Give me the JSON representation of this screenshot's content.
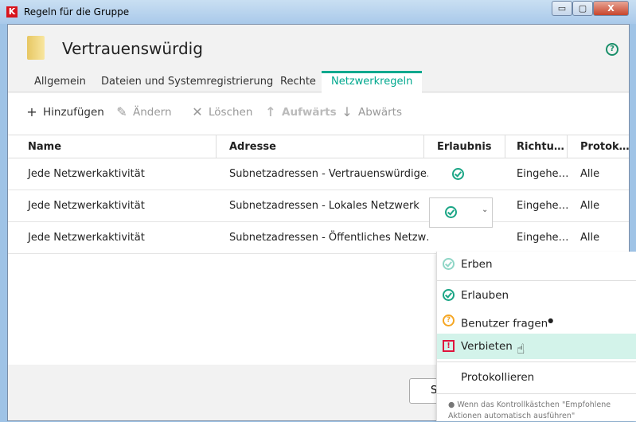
{
  "window": {
    "title": "Regeln für die Gruppe",
    "minimize": "▭",
    "maximize": "▢",
    "close": "X"
  },
  "header": {
    "title": "Vertrauenswürdig",
    "help": "?"
  },
  "tabs": [
    {
      "label": "Allgemein"
    },
    {
      "label": "Dateien und Systemregistrierung"
    },
    {
      "label": "Rechte"
    },
    {
      "label": "Netzwerkregeln",
      "active": true
    }
  ],
  "toolbar": {
    "add": "Hinzufügen",
    "edit": "Ändern",
    "delete": "Löschen",
    "up": "Aufwärts",
    "down": "Abwärts"
  },
  "table": {
    "headers": [
      "Name",
      "Adresse",
      "Erlaubnis",
      "Richtu…",
      "Protok…"
    ],
    "rows": [
      {
        "name": "Jede Netzwerkaktivität",
        "address": "Subnetzadressen - Vertrauenswürdige…",
        "permission": "allow",
        "direction": "Eingehe…",
        "protocol": "Alle"
      },
      {
        "name": "Jede Netzwerkaktivität",
        "address": "Subnetzadressen - Lokales Netzwerk",
        "permission": "allow",
        "direction": "Eingehe…",
        "protocol": "Alle"
      },
      {
        "name": "Jede Netzwerkaktivität",
        "address": "Subnetzadressen - Öffentliches Netzw…",
        "permission": "allow",
        "direction": "Eingehe…",
        "protocol": "Alle"
      }
    ]
  },
  "footer": {
    "button": "S"
  },
  "dropdown": {
    "items": [
      {
        "label": "Erben"
      },
      {
        "label": "Erlauben"
      },
      {
        "label": "Benutzer fragen"
      },
      {
        "label": "Verbieten"
      },
      {
        "label": "Protokollieren"
      }
    ],
    "note": "Wenn das Kontrollkästchen \"Empfohlene Aktionen automatisch ausführen\""
  },
  "colors": {
    "accent": "#00a88e",
    "deny": "#e0143c",
    "ask": "#f5a623",
    "hover": "#d3f3ea"
  }
}
